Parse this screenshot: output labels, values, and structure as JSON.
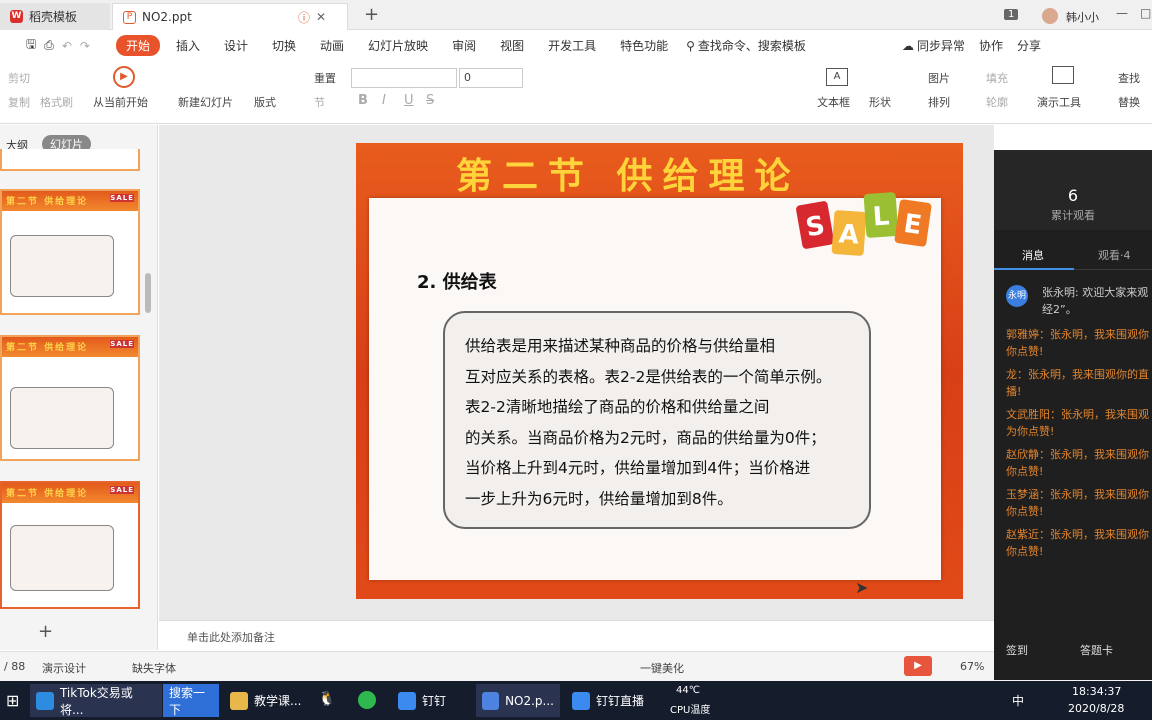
{
  "tabs": {
    "daoke": "稻壳模板",
    "doc": "NO2.ppt",
    "new_tab": "+"
  },
  "user": {
    "name": "韩小小",
    "badge": "1"
  },
  "menu": {
    "items": [
      "开始",
      "插入",
      "设计",
      "切换",
      "动画",
      "幻灯片放映",
      "审阅",
      "视图",
      "开发工具",
      "特色功能"
    ],
    "search": "查找命令、搜索模板",
    "sync": "同步异常",
    "collab": "协作",
    "share": "分享"
  },
  "ribbon": {
    "cut": "剪切",
    "copy": "复制",
    "format_painter": "格式刷",
    "play_from": "从当前开始",
    "new_slide": "新建幻灯片",
    "layout": "版式",
    "reset": "重置",
    "section": "节",
    "font_size": "0",
    "textbox": "文本框",
    "shapes": "形状",
    "picture": "图片",
    "arrange": "排列",
    "fill": "填充",
    "outline": "轮廓",
    "present_tools": "演示工具",
    "find": "查找",
    "replace": "替换"
  },
  "sidebar": {
    "outline": "大纲",
    "slides": "幻灯片",
    "thumb_title": "第二节  供给理论",
    "sale": "SALE"
  },
  "slide": {
    "title": "第二节   供给理论",
    "heading": "2. 供给表",
    "sale_letters": [
      "S",
      "A",
      "L",
      "E"
    ],
    "lines": [
      "    供给表是用来描述某种商品的价格与供给量相",
      "互对应关系的表格。表2-2是供给表的一个简单示例。",
      "    表2-2清晰地描绘了商品的价格和供给量之间",
      "的关系。当商品价格为2元时，商品的供给量为0件；",
      "当价格上升到4元时，供给量增加到4件；当价格进",
      "一步上升为6元时，供给量增加到8件。"
    ]
  },
  "notes": {
    "placeholder": "单击此处添加备注"
  },
  "status": {
    "page": "/ 88",
    "design": "演示设计",
    "missing_font": "缺失字体",
    "beautify": "一键美化",
    "zoom": "67%"
  },
  "live": {
    "viewers": "6",
    "viewers_label": "累计观看",
    "tab_msg": "消息",
    "tab_watch": "观看·4",
    "avatar": "永明",
    "messages": [
      "张永明: 欢迎大家来观",
      "经2”。",
      "郭雅婷：张永明，我来围观你",
      "你点赞!",
      "龙：张永明，我来围观你的直",
      "播!",
      "文武胜阳：张永明，我来围观",
      "为你点赞!",
      "赵欣静：张永明，我来围观你",
      "你点赞!",
      "玉梦涵：张永明，我来围观你",
      "你点赞!",
      "赵紫近：张永明，我来围观你",
      "你点赞!"
    ],
    "signin": "签到",
    "card": "答题卡"
  },
  "taskbar": {
    "tiktok": "TikTok交易或将...",
    "search": "搜索一下",
    "folder": "教学课...",
    "dingding": "钉钉",
    "ppt": "NO2.p...",
    "live": "钉钉直播",
    "temp": "44℃",
    "cpu": "CPU温度",
    "ime": "中",
    "time": "18:34:37",
    "date": "2020/8/28"
  }
}
